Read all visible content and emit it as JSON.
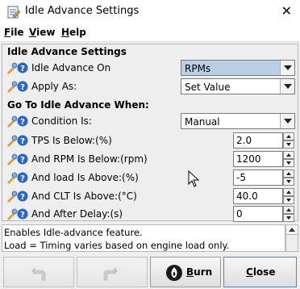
{
  "window": {
    "title": "Idle Advance Settings",
    "close_glyph": "✕"
  },
  "menu": [
    {
      "mnemonic": "F",
      "rest": "ile"
    },
    {
      "mnemonic": "V",
      "rest": "iew"
    },
    {
      "mnemonic": "H",
      "rest": "elp"
    }
  ],
  "section1": {
    "title": "Idle Advance Settings",
    "rows": [
      {
        "label": "Idle Advance On",
        "value": "RPMs",
        "control": "combo",
        "selected": true
      },
      {
        "label": "Apply As:",
        "value": "Set Value",
        "control": "combo",
        "selected": false
      }
    ]
  },
  "section2": {
    "title": "Go To Idle Advance When:",
    "rows": [
      {
        "label": "Condition Is:",
        "value": "Manual",
        "control": "combo"
      },
      {
        "label": "TPS Is Below:(%)",
        "value": "2.0",
        "control": "spinner"
      },
      {
        "label": "And RPM Is Below:(rpm)",
        "value": "1200",
        "control": "spinner"
      },
      {
        "label": "And load Is Above:(%)",
        "value": "-5",
        "control": "spinner"
      },
      {
        "label": "And CLT Is Above:(°C)",
        "value": "40.0",
        "control": "spinner"
      },
      {
        "label": "And After Delay:(s)",
        "value": "0",
        "control": "spinner"
      }
    ]
  },
  "description": {
    "line1": "Enables Idle-advance feature.",
    "line2": "Load = Timing varies based on engine load only."
  },
  "buttons": {
    "undo_icon": "undo-icon",
    "redo_icon": "redo-icon",
    "burn": {
      "mnemonic": "B",
      "rest": "urn",
      "icon": "burn-icon"
    },
    "close": {
      "mnemonic": "C",
      "rest": "lose"
    }
  },
  "colors": {
    "selected_combo": "#b8cfe5",
    "window_bg": "#eeeeee"
  }
}
